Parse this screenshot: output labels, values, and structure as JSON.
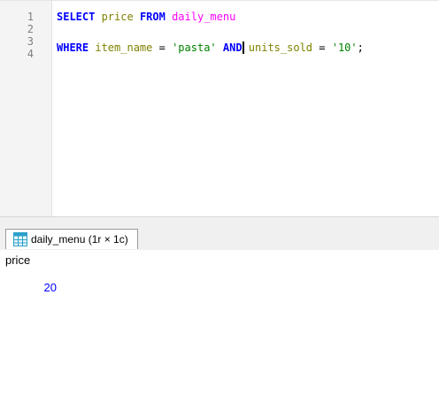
{
  "editor": {
    "line_numbers": [
      "1",
      "2",
      "3",
      "4"
    ],
    "line1": {
      "kw_select": "SELECT",
      "col_price": " price ",
      "kw_from": "FROM",
      "table": " daily_menu"
    },
    "line3": {
      "kw_where": "WHERE",
      "col_item_name": " item_name ",
      "eq1": "=",
      "str_pasta": " 'pasta' ",
      "kw_and": "AND",
      "col_units_sold": " units_sold ",
      "eq2": "=",
      "str_ten": " '10'",
      "semi": ";"
    }
  },
  "results": {
    "tab_label": "daily_menu (1r × 1c)",
    "tab_icon": "table-grid-icon",
    "columns": [
      "price"
    ],
    "rows": [
      [
        "20"
      ]
    ]
  },
  "colors": {
    "keyword": "#0000ff",
    "table_identifier": "#ff00ff",
    "column_identifier": "#808000",
    "string_literal": "#008000",
    "numeric_value": "#0000ff"
  }
}
